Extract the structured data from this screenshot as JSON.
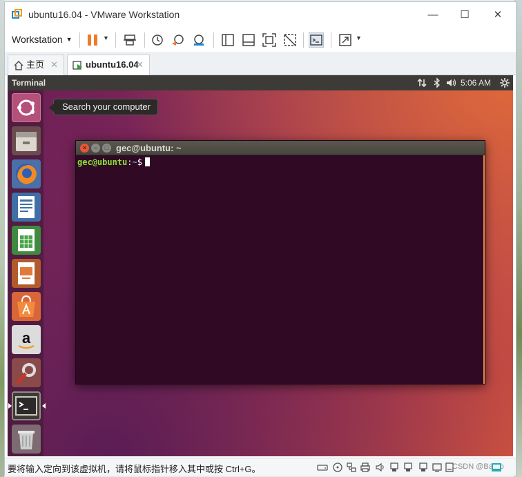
{
  "window": {
    "title": "ubuntu16.04 - VMware Workstation",
    "minimize_glyph": "—",
    "maximize_glyph": "☐",
    "close_glyph": "✕"
  },
  "toolbar": {
    "workstation_menu": "Workstation",
    "icons": [
      "pause-icon",
      "send-ctrl-alt-del-icon",
      "snapshot-icon",
      "revert-snapshot-icon",
      "snapshot-manager-icon",
      "console-view-icon",
      "thumbnail-bar-icon",
      "full-screen-icon",
      "unity-icon",
      "terminal-view-icon",
      "stretch-icon"
    ]
  },
  "tabs": [
    {
      "label": "主页",
      "close": "✕"
    },
    {
      "label": "ubuntu16.04",
      "close": "✕"
    }
  ],
  "guest": {
    "panel": {
      "app_name": "Terminal",
      "clock": "5:06 AM",
      "indicators": [
        "network-icon",
        "bluetooth-icon",
        "volume-icon",
        "settings-gear-icon"
      ]
    },
    "tooltip": "Search your computer",
    "launcher": [
      "ubuntu-dash",
      "files",
      "firefox",
      "libreoffice-writer",
      "libreoffice-calc",
      "libreoffice-impress",
      "ubuntu-software",
      "amazon",
      "system-settings",
      "terminal",
      "trash"
    ],
    "terminal": {
      "title": "gec@ubuntu: ~",
      "prompt_user": "gec@ubuntu",
      "prompt_colon": ":",
      "prompt_path": "~",
      "prompt_dollar": "$"
    }
  },
  "statusbar": {
    "message": "要将输入定向到该虚拟机，请将鼠标指针移入其中或按 Ctrl+G。",
    "watermark": "CSDN @Bardo"
  },
  "colors": {
    "terminal_bg": "#300a24",
    "panel_bg": "#3c3b37",
    "prompt_user": "#8ae234",
    "prompt_path": "#729fcf",
    "vmware_accent": "#1e88d6",
    "pause_orange": "#f07a2a"
  }
}
